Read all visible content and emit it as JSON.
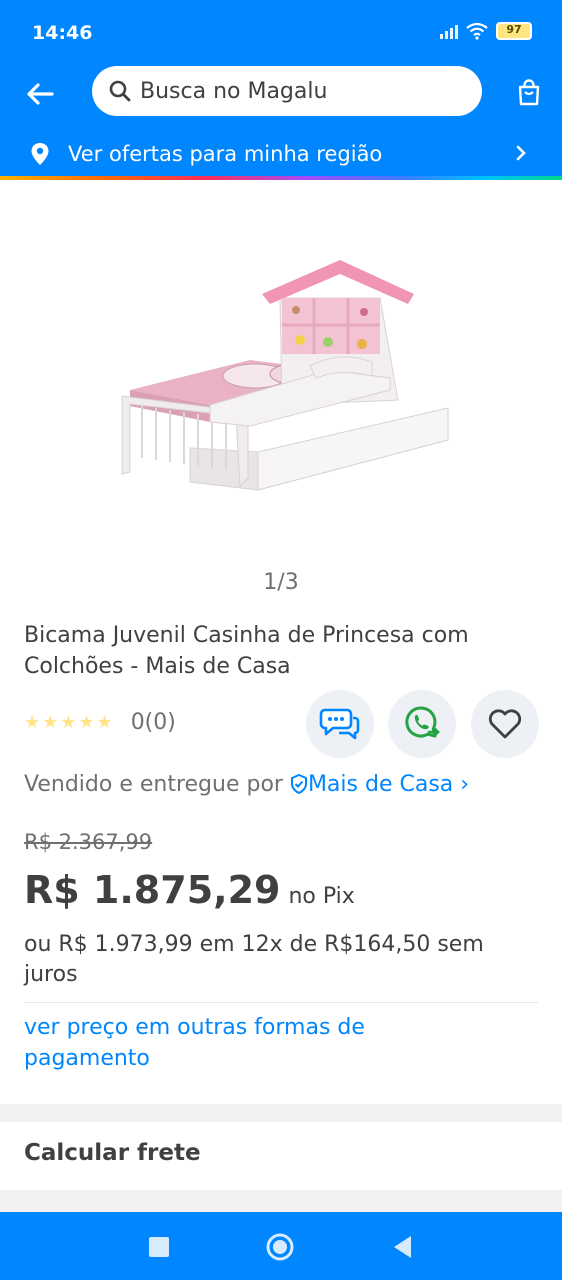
{
  "status_bar": {
    "time": "14:46",
    "battery": "97"
  },
  "header": {
    "search_placeholder": "Busca no Magalu",
    "region_text": "Ver ofertas para minha região"
  },
  "product": {
    "image_pager": "1/3",
    "title": "Bicama Juvenil Casinha de Princesa com Colchões - Mais de Casa",
    "rating_stars": "★★★★★",
    "rating_count": "0(0)",
    "seller_prefix": "Vendido e entregue por",
    "seller_name": "Mais de Casa",
    "seller_arrow": "›",
    "old_price": "R$ 2.367,99",
    "price": "R$ 1.875,29",
    "price_suffix": "no Pix",
    "installments": "ou R$ 1.973,99 em 12x de R$164,50 sem juros",
    "other_payments_link": "ver preço em outras formas de pagamento"
  },
  "shipping": {
    "label": "Calcular frete"
  },
  "colors": {
    "brand_blue": "#0086ff",
    "whatsapp_green": "#25a244",
    "text": "#404040"
  },
  "icons": [
    "back-arrow-icon",
    "search-icon",
    "bag-icon",
    "location-pin-icon",
    "chevron-right-icon",
    "chat-icon",
    "whatsapp-icon",
    "heart-icon",
    "verified-shield-icon",
    "nav-square-icon",
    "nav-circle-icon",
    "nav-back-icon"
  ]
}
